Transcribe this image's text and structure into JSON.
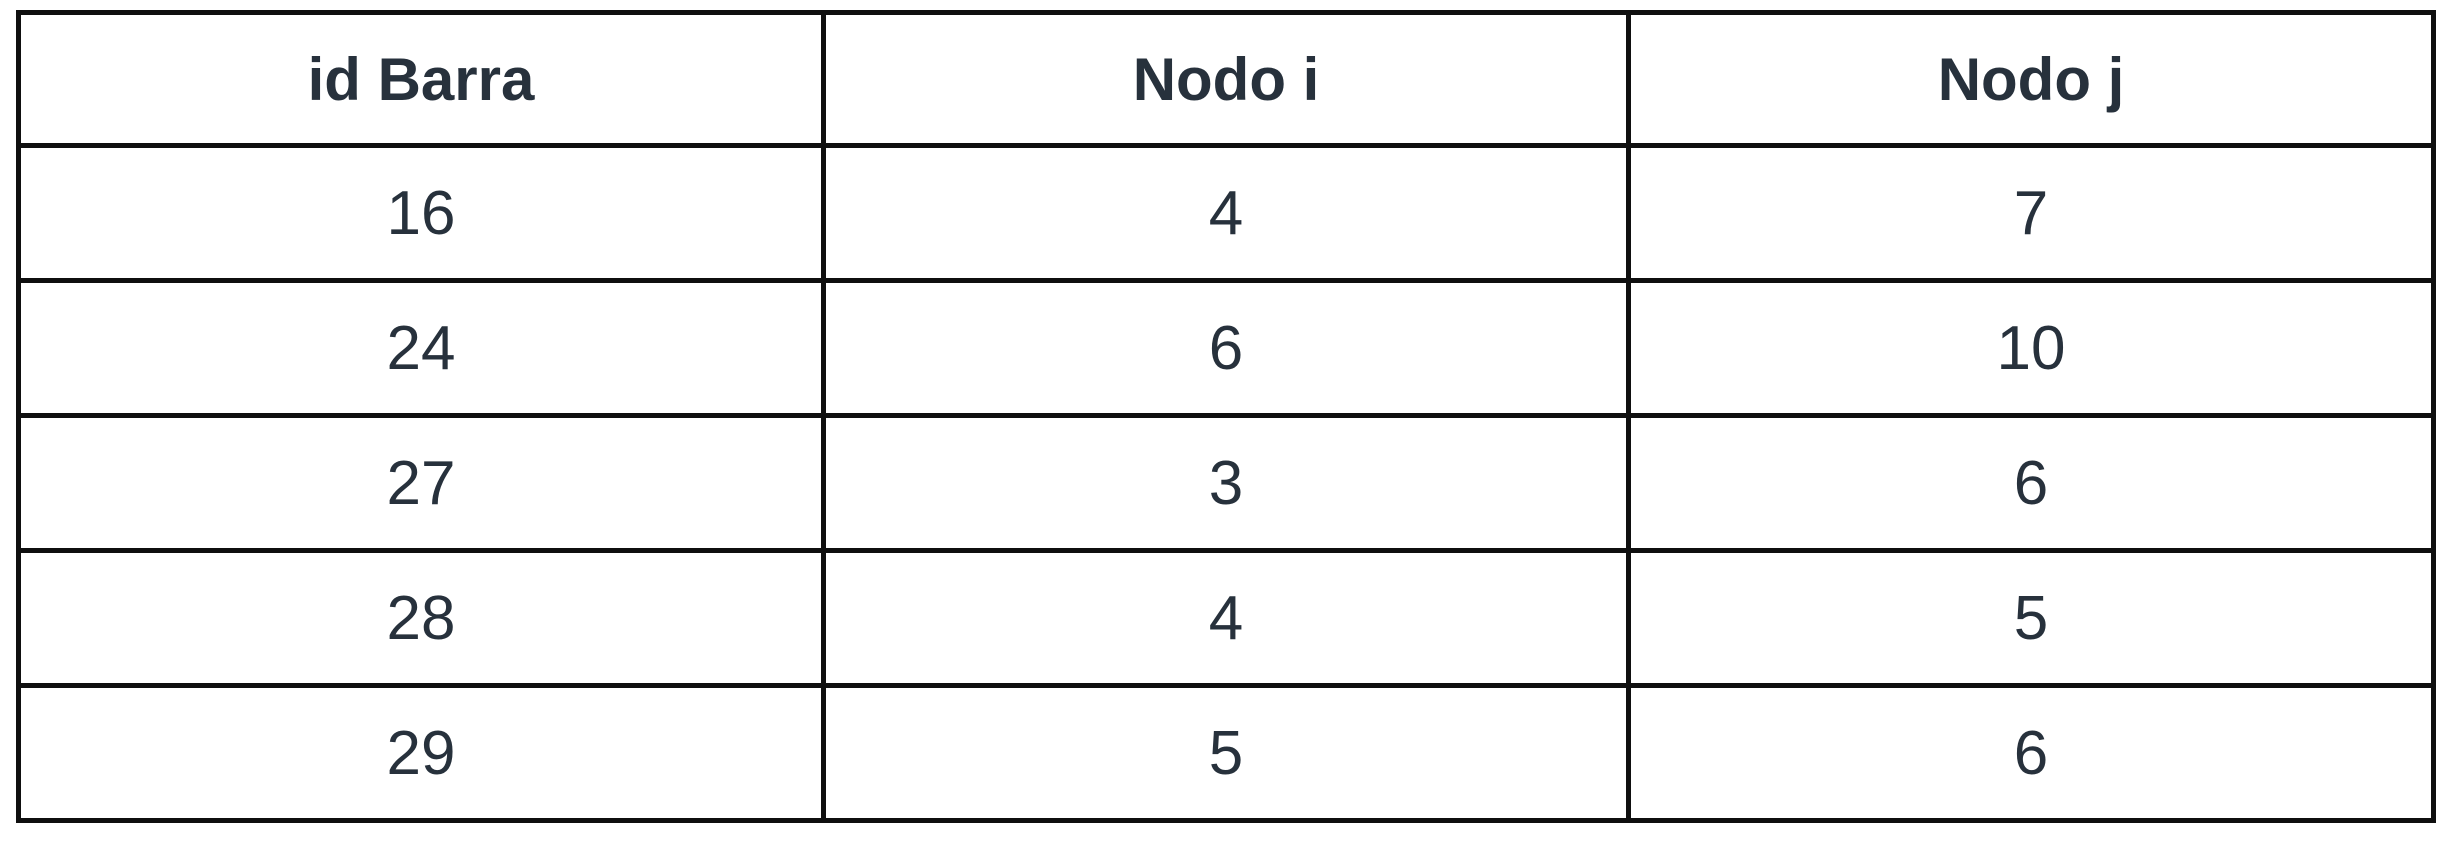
{
  "table": {
    "columns": [
      "id Barra",
      "Nodo i",
      "Nodo j"
    ],
    "rows": [
      [
        "16",
        "4",
        "7"
      ],
      [
        "24",
        "6",
        "10"
      ],
      [
        "27",
        "3",
        "6"
      ],
      [
        "28",
        "4",
        "5"
      ],
      [
        "29",
        "5",
        "6"
      ]
    ]
  }
}
